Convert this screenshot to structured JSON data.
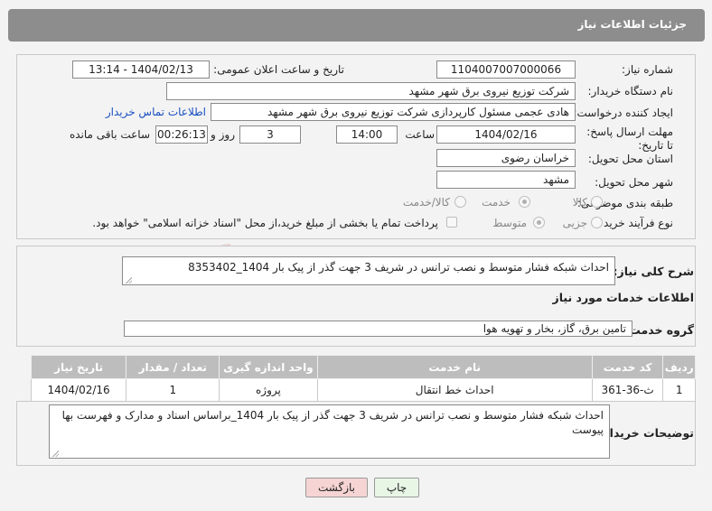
{
  "header": {
    "title": "جزئیات اطلاعات نیاز"
  },
  "fields": {
    "need_number_label": "شماره نیاز:",
    "need_number": "1104007007000066",
    "announce_label": "تاریخ و ساعت اعلان عمومی:",
    "announce_value": "1404/02/13 - 13:14",
    "buyer_org_label": "نام دستگاه خریدار:",
    "buyer_org": "شرکت توزیع نیروی برق شهر مشهد",
    "creator_label": "ایجاد کننده درخواست:",
    "creator": "هادی عجمی مسئول کارپردازی شرکت توزیع نیروی برق شهر مشهد",
    "contact_link": "اطلاعات تماس خریدار",
    "deadline_label": "مهلت ارسال پاسخ: تا تاریخ:",
    "deadline_date": "1404/02/16",
    "time_label": "ساعت",
    "deadline_time": "14:00",
    "days_value": "3",
    "days_label": "روز و",
    "remaining_time": "00:26:13",
    "remaining_label": "ساعت باقی مانده",
    "province_label": "استان محل تحویل:",
    "province": "خراسان رضوی",
    "city_label": "شهر محل تحویل:",
    "city": "مشهد",
    "category_label": "طبقه بندی موضوعی:",
    "category_options": [
      "کالا",
      "خدمت",
      "کالا/خدمت"
    ],
    "category_selected": "خدمت",
    "purchase_type_label": "نوع فرآیند خرید :",
    "purchase_options": [
      "جزیی",
      "متوسط"
    ],
    "purchase_selected": "متوسط",
    "treasury_note": "پرداخت تمام یا بخشی از مبلغ خرید،از محل \"اسناد خزانه اسلامی\" خواهد بود."
  },
  "summary": {
    "label": "شرح کلی نیاز:",
    "text": "احداث شبکه فشار متوسط و نصب ترانس در شریف 3 جهت گذر از پیک بار 1404_8353402"
  },
  "services": {
    "section_title": "اطلاعات خدمات مورد نیاز",
    "group_label": "گروه خدمت:",
    "group_value": "تامین برق، گاز، بخار و تهویه هوا",
    "table": {
      "headers": [
        "ردیف",
        "کد خدمت",
        "نام خدمت",
        "واحد اندازه گیری",
        "تعداد / مقدار",
        "تاریخ نیاز"
      ],
      "rows": [
        [
          "1",
          "ث-36-361",
          "احداث خط انتقال",
          "پروژه",
          "1",
          "1404/02/16"
        ]
      ]
    }
  },
  "buyer_notes": {
    "label": "توضیحات خریدار:",
    "text": "احداث شبکه فشار متوسط و نصب ترانس در شریف 3 جهت گذر از پیک بار 1404_براساس اسناد و مدارک و فهرست بها پیوست"
  },
  "buttons": {
    "print": "چاپ",
    "back": "بازگشت"
  },
  "watermark_text": "AriaTender.neT",
  "colors": {
    "header_bg": "#8d8d8d",
    "link": "#1a4fc0",
    "back_btn_bg": "#f7d4d4",
    "print_btn_bg": "#e8f6e6"
  }
}
